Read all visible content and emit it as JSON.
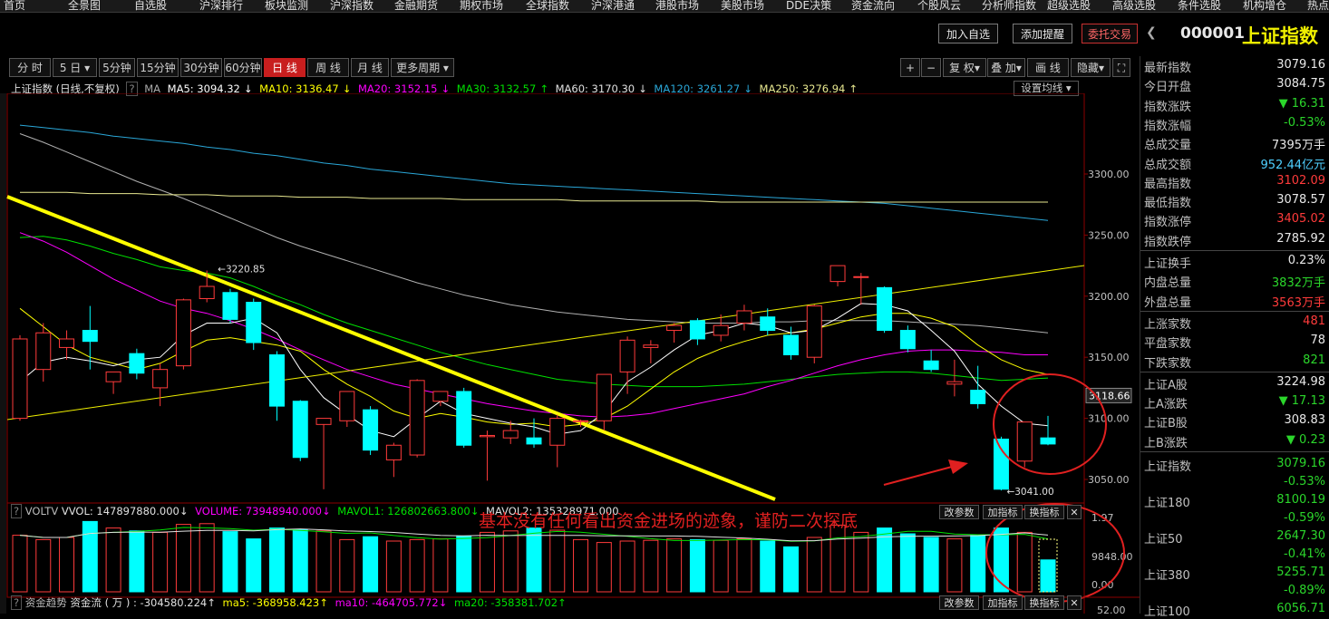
{
  "top_menu": [
    "首页",
    "全景图",
    "自选股",
    "沪深排行",
    "板块监测",
    "沪深指数",
    "金融期货",
    "期权市场",
    "全球指数",
    "沪深港通",
    "港股市场",
    "美股市场",
    "DDE决策",
    "资金流向",
    "个股风云",
    "分析师指数",
    "超级选股",
    "高级选股",
    "条件选股",
    "机构增仓",
    "热点"
  ],
  "header_buttons": {
    "add_watch": "加入自选",
    "add_alert": "添加提醒",
    "order": "委托交易"
  },
  "stock": {
    "code": "000001",
    "name": "上证指数"
  },
  "periods": [
    "分 时",
    "5 日",
    "5分钟",
    "15分钟",
    "30分钟",
    "60分钟",
    "日 线",
    "周 线",
    "月 线",
    "更多周期"
  ],
  "active_period": "日 线",
  "tools": {
    "plus": "+",
    "minus": "−",
    "restore": "复 权",
    "overlay": "叠 加",
    "draw": "画 线",
    "hide": "隐藏",
    "fullscreen": "⛶"
  },
  "ma_legend": {
    "prefix": "上证指数 (日线,不复权)",
    "q": "?",
    "ma": "MA",
    "ma5": "MA5: 3094.32",
    "ma10": "MA10: 3136.47",
    "ma20": "MA20: 3152.15",
    "ma30": "MA30: 3132.57",
    "ma60": "MA60: 3170.30",
    "ma120": "MA120: 3261.27",
    "ma250": "MA250: 3276.94",
    "settings": "设置均线"
  },
  "vol_legend": {
    "name": "VOLTV",
    "vvol": "VVOL: 147897880.000",
    "volume": "VOLUME: 73948940.000",
    "mavol1": "MAVOL1: 126802663.800",
    "mavol2": "MAVOL2: 135328971.000"
  },
  "flow_legend": {
    "name": "资金趋势",
    "flow": "资金流 ( 万 ) : -304580.224",
    "ma5": "ma5: -368958.423",
    "ma10": "ma10: -464705.772",
    "ma20": "ma20: -358381.702"
  },
  "panel_buttons": {
    "params": "改参数",
    "add": "加指标",
    "switch": "换指标",
    "close": "✕"
  },
  "annotation": "基本没有任何看出资金进场的迹象，谨防二次探底",
  "colors": {
    "up": "#ff3b3b",
    "down": "#00ffff",
    "ma5": "#ffffff",
    "ma10": "#ffff00",
    "ma20": "#ff00ff",
    "ma30": "#00e000",
    "ma60": "#b0b0b0",
    "ma120": "#2aa7d8",
    "ma250": "#e8e890"
  },
  "right_panel": [
    {
      "label": "最新指数",
      "value": "3079.16",
      "color": "white"
    },
    {
      "label": "今日开盘",
      "value": "3084.75",
      "color": "white"
    },
    {
      "label": "指数涨跌",
      "value": "▼ 16.31",
      "color": "green"
    },
    {
      "label": "指数涨幅",
      "value": "-0.53%",
      "color": "green"
    },
    {
      "label": "总成交量",
      "value": "7395万手",
      "color": "white"
    },
    {
      "label": "总成交额",
      "value": "952.44亿元",
      "color": "white"
    },
    {
      "label": "最高指数",
      "value": "3102.09",
      "color": "red"
    },
    {
      "label": "最低指数",
      "value": "3078.57",
      "color": "white"
    },
    {
      "label": "指数涨停",
      "value": "3405.02",
      "color": "red"
    },
    {
      "label": "指数跌停",
      "value": "2785.92",
      "color": "white"
    },
    {
      "label": "上证换手",
      "value": "0.23%",
      "color": "white"
    },
    {
      "label": "内盘总量",
      "value": "3832万手",
      "color": "green"
    },
    {
      "label": "外盘总量",
      "value": "3563万手",
      "color": "red"
    },
    {
      "label": "上涨家数",
      "value": "481",
      "color": "red"
    },
    {
      "label": "平盘家数",
      "value": "78",
      "color": "white"
    },
    {
      "label": "下跌家数",
      "value": "821",
      "color": "green"
    },
    {
      "label": "上证A股",
      "value": "3224.98",
      "color": "white"
    },
    {
      "label": "上A涨跌",
      "value": "▼ 17.13",
      "color": "green"
    },
    {
      "label": "上证B股",
      "value": "308.83",
      "color": "white"
    },
    {
      "label": "上B涨跌",
      "value": "▼ 0.23",
      "color": "green"
    }
  ],
  "right_indices": [
    {
      "label": "上证指数",
      "value": "3079.16",
      "change": "-0.53%"
    },
    {
      "label": "上证180",
      "value": "8100.19",
      "change": "-0.59%"
    },
    {
      "label": "上证50",
      "value": "2647.30",
      "change": "-0.41%"
    },
    {
      "label": "上证380",
      "value": "5255.71",
      "change": "-0.89%"
    },
    {
      "label": "上证100",
      "value": "6056.71",
      "change": ""
    }
  ],
  "chart_data": {
    "type": "candlestick",
    "y_ticks": [
      3300,
      3250,
      3200,
      3150,
      3100,
      3050
    ],
    "y_tick_labels": [
      "3300.00",
      "3250.00",
      "3200.00",
      "3150.00",
      "3100.00",
      "3050.00"
    ],
    "current_price_label": "3118.66",
    "ylim": [
      3030,
      3350
    ],
    "annotations": {
      "high": "3220.85",
      "low": "3041.00"
    },
    "candles": [
      {
        "o": 3100,
        "h": 3168,
        "c": 3165,
        "l": 3098
      },
      {
        "o": 3140,
        "h": 3178,
        "c": 3170,
        "l": 3130
      },
      {
        "o": 3158,
        "h": 3172,
        "c": 3165,
        "l": 3148
      },
      {
        "o": 3172,
        "h": 3192,
        "c": 3163,
        "l": 3140
      },
      {
        "o": 3130,
        "h": 3138,
        "c": 3138,
        "l": 3120
      },
      {
        "o": 3153,
        "h": 3157,
        "c": 3137,
        "l": 3132
      },
      {
        "o": 3125,
        "h": 3145,
        "c": 3140,
        "l": 3110
      },
      {
        "o": 3143,
        "h": 3198,
        "c": 3197,
        "l": 3140
      },
      {
        "o": 3198,
        "h": 3221,
        "c": 3208,
        "l": 3195
      },
      {
        "o": 3203,
        "h": 3206,
        "c": 3181,
        "l": 3178
      },
      {
        "o": 3195,
        "h": 3198,
        "c": 3162,
        "l": 3156
      },
      {
        "o": 3152,
        "h": 3155,
        "c": 3110,
        "l": 3098
      },
      {
        "o": 3114,
        "h": 3115,
        "c": 3068,
        "l": 3065
      },
      {
        "o": 3095,
        "h": 3100,
        "c": 3100,
        "l": 3042
      },
      {
        "o": 3098,
        "h": 3122,
        "c": 3122,
        "l": 3093
      },
      {
        "o": 3107,
        "h": 3110,
        "c": 3074,
        "l": 3070
      },
      {
        "o": 3066,
        "h": 3080,
        "c": 3078,
        "l": 3052
      },
      {
        "o": 3070,
        "h": 3132,
        "c": 3131,
        "l": 3068
      },
      {
        "o": 3114,
        "h": 3120,
        "c": 3122,
        "l": 3110
      },
      {
        "o": 3122,
        "h": 3125,
        "c": 3078,
        "l": 3076
      },
      {
        "o": 3085,
        "h": 3090,
        "c": 3086,
        "l": 3049
      },
      {
        "o": 3084,
        "h": 3098,
        "c": 3090,
        "l": 3079
      },
      {
        "o": 3084,
        "h": 3100,
        "c": 3079,
        "l": 3076
      },
      {
        "o": 3078,
        "h": 3103,
        "c": 3100,
        "l": 3060
      },
      {
        "o": 3098,
        "h": 3099,
        "c": 3098,
        "l": 3093
      },
      {
        "o": 3098,
        "h": 3136,
        "c": 3136,
        "l": 3090
      },
      {
        "o": 3138,
        "h": 3167,
        "c": 3164,
        "l": 3120
      },
      {
        "o": 3158,
        "h": 3164,
        "c": 3160,
        "l": 3145
      },
      {
        "o": 3172,
        "h": 3178,
        "c": 3176,
        "l": 3162
      },
      {
        "o": 3180,
        "h": 3182,
        "c": 3165,
        "l": 3160
      },
      {
        "o": 3168,
        "h": 3185,
        "c": 3176,
        "l": 3163
      },
      {
        "o": 3178,
        "h": 3193,
        "c": 3188,
        "l": 3172
      },
      {
        "o": 3183,
        "h": 3190,
        "c": 3172,
        "l": 3168
      },
      {
        "o": 3168,
        "h": 3175,
        "c": 3152,
        "l": 3148
      },
      {
        "o": 3150,
        "h": 3193,
        "c": 3192,
        "l": 3145
      },
      {
        "o": 3212,
        "h": 3222,
        "c": 3225,
        "l": 3208
      },
      {
        "o": 3216,
        "h": 3219,
        "c": 3216,
        "l": 3193
      },
      {
        "o": 3207,
        "h": 3208,
        "c": 3172,
        "l": 3170
      },
      {
        "o": 3172,
        "h": 3176,
        "c": 3157,
        "l": 3154
      },
      {
        "o": 3147,
        "h": 3156,
        "c": 3140,
        "l": 3138
      },
      {
        "o": 3128,
        "h": 3148,
        "c": 3130,
        "l": 3118
      },
      {
        "o": 3123,
        "h": 3143,
        "c": 3112,
        "l": 3108
      },
      {
        "o": 3083,
        "h": 3085,
        "c": 3042,
        "l": 3041
      },
      {
        "o": 3065,
        "h": 3097,
        "c": 3097,
        "l": 3060
      },
      {
        "o": 3084,
        "h": 3102,
        "c": 3079,
        "l": 3078
      }
    ],
    "ma5": [
      3130,
      3146,
      3150,
      3147,
      3143,
      3148,
      3150,
      3168,
      3178,
      3178,
      3182,
      3170,
      3140,
      3117,
      3103,
      3090,
      3085,
      3100,
      3114,
      3104,
      3100,
      3096,
      3093,
      3087,
      3090,
      3105,
      3130,
      3142,
      3156,
      3168,
      3172,
      3178,
      3176,
      3170,
      3172,
      3182,
      3194,
      3193,
      3188,
      3172,
      3155,
      3128,
      3110,
      3096,
      3094
    ],
    "ma10": [
      3190,
      3175,
      3160,
      3150,
      3145,
      3140,
      3145,
      3155,
      3164,
      3166,
      3163,
      3160,
      3155,
      3140,
      3128,
      3118,
      3106,
      3100,
      3104,
      3101,
      3097,
      3095,
      3096,
      3093,
      3095,
      3100,
      3110,
      3124,
      3138,
      3149,
      3157,
      3163,
      3168,
      3170,
      3173,
      3178,
      3183,
      3186,
      3186,
      3182,
      3175,
      3160,
      3148,
      3140,
      3136
    ],
    "ma20": [
      3252,
      3245,
      3236,
      3225,
      3214,
      3205,
      3196,
      3190,
      3186,
      3180,
      3173,
      3165,
      3156,
      3148,
      3140,
      3134,
      3128,
      3124,
      3120,
      3116,
      3112,
      3109,
      3106,
      3104,
      3102,
      3101,
      3102,
      3104,
      3108,
      3112,
      3116,
      3120,
      3126,
      3131,
      3137,
      3143,
      3148,
      3152,
      3155,
      3156,
      3156,
      3155,
      3154,
      3152,
      3152
    ],
    "ma30": [
      3248,
      3249,
      3246,
      3241,
      3235,
      3230,
      3224,
      3221,
      3219,
      3215,
      3208,
      3200,
      3193,
      3185,
      3178,
      3172,
      3166,
      3160,
      3154,
      3149,
      3144,
      3140,
      3136,
      3132,
      3130,
      3128,
      3127,
      3126,
      3126,
      3126,
      3127,
      3128,
      3130,
      3132,
      3134,
      3136,
      3137,
      3138,
      3138,
      3137,
      3135,
      3133,
      3131,
      3132,
      3133
    ],
    "ma60": [
      3333,
      3326,
      3318,
      3310,
      3302,
      3294,
      3287,
      3280,
      3272,
      3264,
      3256,
      3248,
      3241,
      3235,
      3229,
      3223,
      3217,
      3211,
      3206,
      3201,
      3197,
      3193,
      3190,
      3187,
      3185,
      3183,
      3181,
      3180,
      3179,
      3178,
      3178,
      3178,
      3179,
      3179,
      3180,
      3180,
      3180,
      3180,
      3179,
      3178,
      3177,
      3176,
      3174,
      3172,
      3170
    ],
    "ma120": [
      3340,
      3338,
      3336,
      3334,
      3331,
      3329,
      3327,
      3325,
      3322,
      3320,
      3317,
      3315,
      3312,
      3309,
      3307,
      3304,
      3302,
      3300,
      3298,
      3296,
      3294,
      3292,
      3291,
      3290,
      3289,
      3288,
      3287,
      3286,
      3285,
      3284,
      3283,
      3282,
      3281,
      3280,
      3279,
      3278,
      3277,
      3276,
      3274,
      3272,
      3270,
      3268,
      3266,
      3264,
      3262
    ],
    "ma250": [
      3285,
      3285,
      3285,
      3284,
      3284,
      3284,
      3283,
      3283,
      3283,
      3282,
      3282,
      3282,
      3281,
      3281,
      3281,
      3280,
      3280,
      3280,
      3280,
      3279,
      3279,
      3279,
      3279,
      3279,
      3278,
      3278,
      3278,
      3278,
      3278,
      3278,
      3277,
      3277,
      3277,
      3277,
      3277,
      3277,
      3277,
      3277,
      3277,
      3277,
      3277,
      3277,
      3277,
      3277,
      3277
    ],
    "volume_ticks": [
      "1.97",
      "9848.00",
      "0.00"
    ],
    "volume": [
      0.78,
      0.72,
      0.75,
      0.97,
      0.88,
      0.84,
      0.82,
      0.93,
      0.94,
      0.83,
      0.73,
      0.88,
      0.86,
      0.84,
      0.72,
      0.76,
      0.7,
      0.72,
      0.73,
      0.77,
      0.82,
      0.84,
      0.88,
      0.85,
      0.72,
      0.68,
      0.7,
      0.71,
      0.73,
      0.72,
      0.71,
      0.73,
      0.7,
      0.62,
      0.75,
      0.92,
      0.82,
      0.88,
      0.8,
      0.75,
      0.73,
      0.78,
      0.88,
      0.82,
      0.44
    ],
    "flow_tick": "52.00"
  }
}
